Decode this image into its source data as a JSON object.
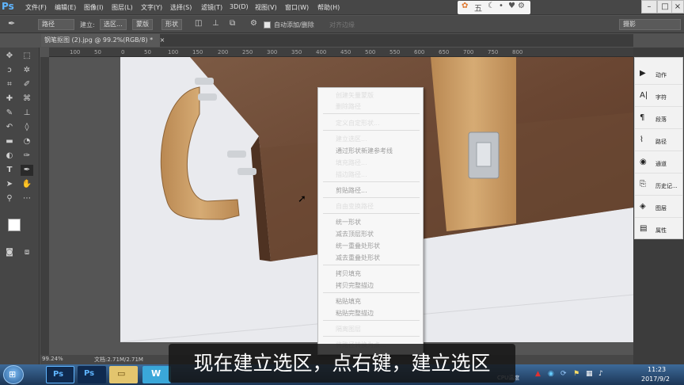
{
  "app": {
    "logo": "Ps"
  },
  "menu": [
    "文件(F)",
    "编辑(E)",
    "图像(I)",
    "图层(L)",
    "文字(Y)",
    "选择(S)",
    "滤镜(T)",
    "3D(D)",
    "视图(V)",
    "窗口(W)",
    "帮助(H)"
  ],
  "ime": {
    "char": "五",
    "icons": [
      "paw-icon",
      "moon-icon",
      "dot-icon",
      "skin-icon",
      "gear-icon"
    ]
  },
  "options": {
    "mode": "路径",
    "build_label": "建立:",
    "build_btn": "选区...",
    "mask_btn": "蒙版",
    "shape_btn": "形状",
    "auto_add": "自动添加/删除",
    "align_edges": "对齐边缘",
    "workspace": "摄影"
  },
  "document": {
    "tab": "钢笔抠图 (2).jpg @ 99.2%(RGB/8) *"
  },
  "ruler": {
    "marks": [
      "100",
      "50",
      "0",
      "50",
      "100",
      "150",
      "200",
      "250",
      "300",
      "350",
      "400",
      "450",
      "500",
      "550",
      "600",
      "650",
      "700",
      "750",
      "800"
    ]
  },
  "status": {
    "zoom": "99.24%",
    "doc": "文档:2.71M/2.71M"
  },
  "context_menu": {
    "items": [
      {
        "label": "创建矢量蒙版",
        "enabled": true
      },
      {
        "label": "删除路径",
        "enabled": true
      },
      {
        "label": "定义自定形状...",
        "enabled": true
      },
      {
        "label": "建立选区...",
        "enabled": true
      },
      {
        "label": "通过形状新建参考线",
        "enabled": false
      },
      {
        "label": "填充路径...",
        "enabled": true
      },
      {
        "label": "描边路径...",
        "enabled": true
      },
      {
        "label": "剪贴路径...",
        "enabled": false
      },
      {
        "label": "自由变换路径",
        "enabled": true
      },
      {
        "label": "统一形状",
        "enabled": false
      },
      {
        "label": "减去顶层形状",
        "enabled": false
      },
      {
        "label": "统一重叠处形状",
        "enabled": false
      },
      {
        "label": "减去重叠处形状",
        "enabled": false
      },
      {
        "label": "拷贝填充",
        "enabled": false
      },
      {
        "label": "拷贝完整描边",
        "enabled": false
      },
      {
        "label": "粘贴填充",
        "enabled": false
      },
      {
        "label": "粘贴完整描边",
        "enabled": false
      },
      {
        "label": "隔离图层",
        "enabled": true
      },
      {
        "label": "将路径转换为点…",
        "enabled": true
      }
    ]
  },
  "panels": [
    {
      "icon": "play-icon",
      "label": "动作"
    },
    {
      "icon": "character-icon",
      "label": "字符"
    },
    {
      "icon": "paragraph-icon",
      "label": "段落"
    },
    {
      "icon": "paths-icon",
      "label": "路径"
    },
    {
      "icon": "channels-icon",
      "label": "通道"
    },
    {
      "icon": "history-icon",
      "label": "历史记..."
    },
    {
      "icon": "layers-icon",
      "label": "图层"
    },
    {
      "icon": "properties-icon",
      "label": "属性"
    }
  ],
  "subtitle": "现在建立选区，点右键，建立选区",
  "taskbar": {
    "time": "11:23",
    "date": "2017/9/2",
    "cpu": "CPU温度"
  },
  "colors": {
    "ps_blue": "#5fb5ff",
    "menu_bg": "#474747",
    "canvas": "#e9eaee",
    "leather": "#6b4a36",
    "strap": "#c79a62"
  }
}
